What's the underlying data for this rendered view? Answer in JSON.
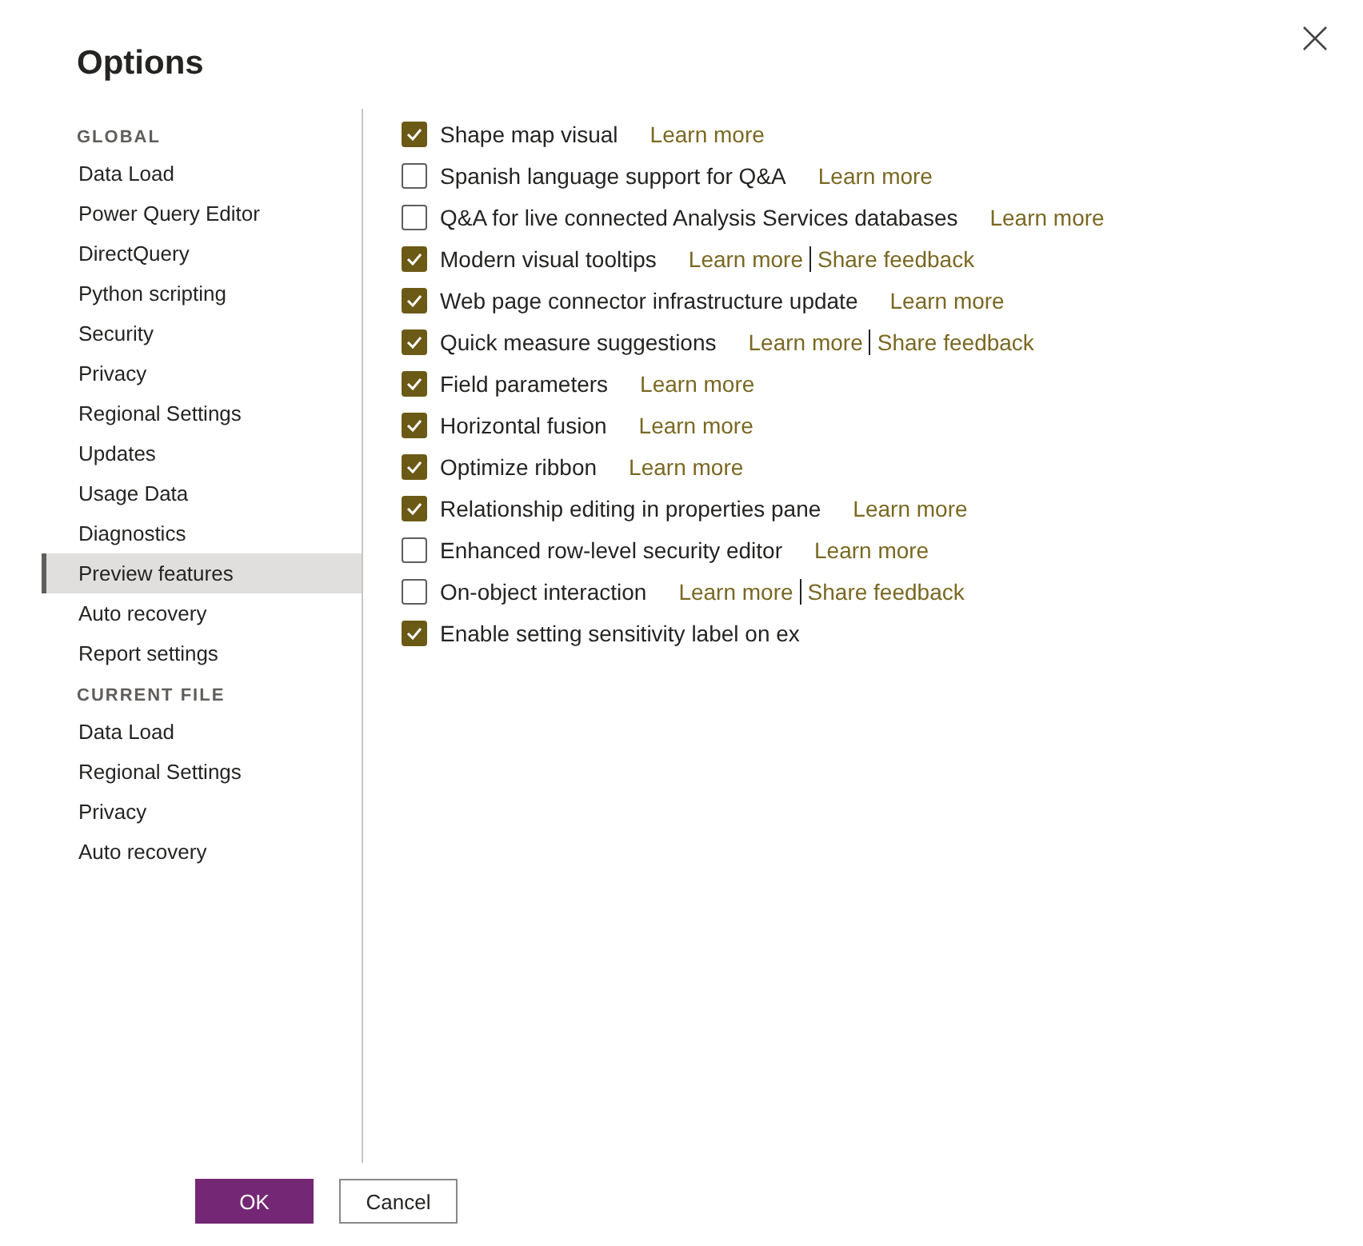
{
  "window": {
    "title": "Options"
  },
  "sidebar": {
    "sections": [
      {
        "heading": "GLOBAL",
        "items": [
          {
            "label": "Data Load",
            "selected": false
          },
          {
            "label": "Power Query Editor",
            "selected": false
          },
          {
            "label": "DirectQuery",
            "selected": false
          },
          {
            "label": "Python scripting",
            "selected": false
          },
          {
            "label": "Security",
            "selected": false
          },
          {
            "label": "Privacy",
            "selected": false
          },
          {
            "label": "Regional Settings",
            "selected": false
          },
          {
            "label": "Updates",
            "selected": false
          },
          {
            "label": "Usage Data",
            "selected": false
          },
          {
            "label": "Diagnostics",
            "selected": false
          },
          {
            "label": "Preview features",
            "selected": true
          },
          {
            "label": "Auto recovery",
            "selected": false
          },
          {
            "label": "Report settings",
            "selected": false
          }
        ]
      },
      {
        "heading": "CURRENT FILE",
        "items": [
          {
            "label": "Data Load",
            "selected": false
          },
          {
            "label": "Regional Settings",
            "selected": false
          },
          {
            "label": "Privacy",
            "selected": false
          },
          {
            "label": "Auto recovery",
            "selected": false
          }
        ]
      }
    ]
  },
  "features": [
    {
      "label": "Shape map visual",
      "checked": true,
      "links": [
        "Learn more"
      ]
    },
    {
      "label": "Spanish language support for Q&A",
      "checked": false,
      "links": [
        "Learn more"
      ]
    },
    {
      "label": "Q&A for live connected Analysis Services databases",
      "checked": false,
      "links": [
        "Learn more"
      ]
    },
    {
      "label": "Modern visual tooltips",
      "checked": true,
      "links": [
        "Learn more",
        "Share feedback"
      ]
    },
    {
      "label": "Web page connector infrastructure update",
      "checked": true,
      "links": [
        "Learn more"
      ]
    },
    {
      "label": "Quick measure suggestions",
      "checked": true,
      "links": [
        "Learn more",
        "Share feedback"
      ]
    },
    {
      "label": "Field parameters",
      "checked": true,
      "links": [
        "Learn more"
      ]
    },
    {
      "label": "Horizontal fusion",
      "checked": true,
      "links": [
        "Learn more"
      ]
    },
    {
      "label": "Optimize ribbon",
      "checked": true,
      "links": [
        "Learn more"
      ]
    },
    {
      "label": "Relationship editing in properties pane",
      "checked": true,
      "links": [
        "Learn more"
      ]
    },
    {
      "label": "Enhanced row-level security editor",
      "checked": false,
      "links": [
        "Learn more"
      ]
    },
    {
      "label": "On-object interaction",
      "checked": false,
      "links": [
        "Learn more",
        "Share feedback"
      ]
    },
    {
      "label": "Enable setting sensitivity label on ex",
      "checked": true
    }
  ],
  "buttons": [
    {
      "label": "OK",
      "kind": "primary"
    },
    {
      "label": "Cancel",
      "kind": "secondary"
    }
  ]
}
